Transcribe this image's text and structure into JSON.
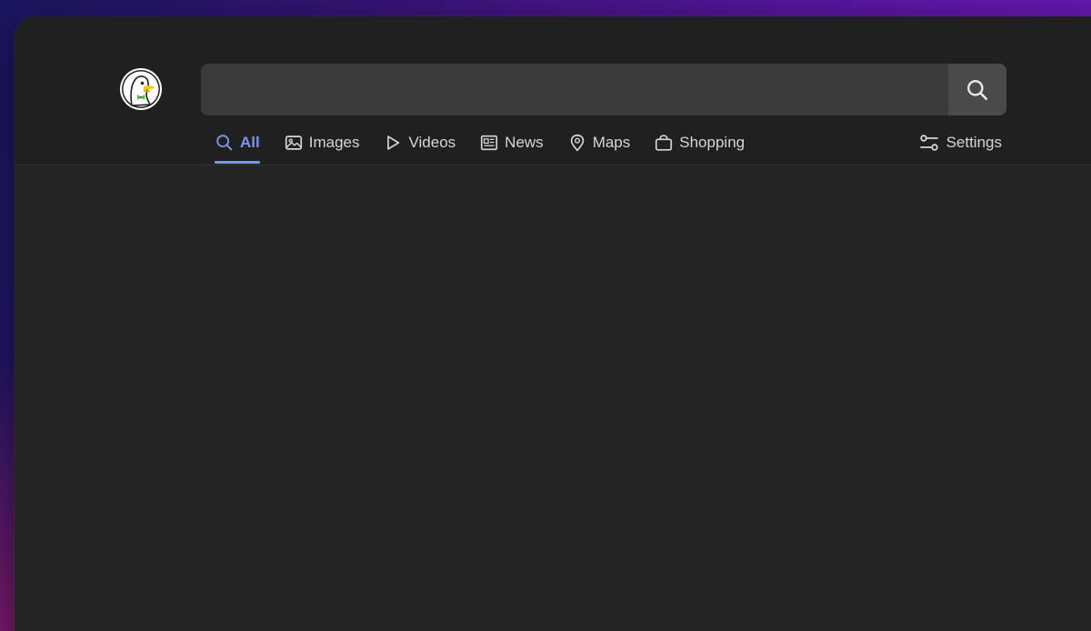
{
  "search": {
    "value": "",
    "placeholder": ""
  },
  "tabs": [
    {
      "label": "All",
      "icon": "search-icon",
      "active": true
    },
    {
      "label": "Images",
      "icon": "image-icon",
      "active": false
    },
    {
      "label": "Videos",
      "icon": "play-icon",
      "active": false
    },
    {
      "label": "News",
      "icon": "newspaper-icon",
      "active": false
    },
    {
      "label": "Maps",
      "icon": "map-pin-icon",
      "active": false
    },
    {
      "label": "Shopping",
      "icon": "shopping-bag-icon",
      "active": false
    }
  ],
  "settings": {
    "label": "Settings",
    "icon": "sliders-icon"
  },
  "colors": {
    "accent": "#7b95f0",
    "header_bg": "#202020",
    "page_bg": "#242424",
    "search_bg": "#3a3a3a"
  }
}
